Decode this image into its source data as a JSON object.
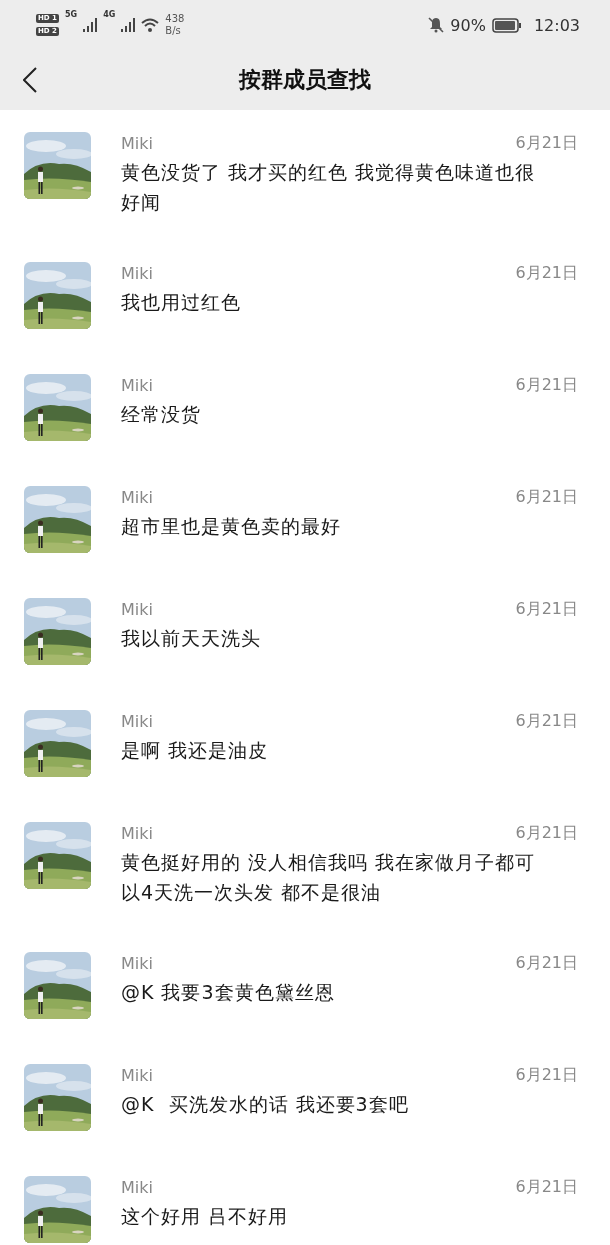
{
  "status_bar": {
    "sims": [
      {
        "label": "HD",
        "slot": "1"
      },
      {
        "label": "HD",
        "slot": "2"
      }
    ],
    "networks": [
      "5G",
      "4G"
    ],
    "speed": "438",
    "speed_unit": "B/s",
    "battery": "90%",
    "time": "12:03"
  },
  "header": {
    "title": "按群成员查找"
  },
  "messages": [
    {
      "name": "Miki",
      "date": "6月21日",
      "text": "黄色没货了 我才买的红色 我觉得黄色味道也很好闻"
    },
    {
      "name": "Miki",
      "date": "6月21日",
      "text": "我也用过红色"
    },
    {
      "name": "Miki",
      "date": "6月21日",
      "text": "经常没货"
    },
    {
      "name": "Miki",
      "date": "6月21日",
      "text": "超市里也是黄色卖的最好"
    },
    {
      "name": "Miki",
      "date": "6月21日",
      "text": "我以前天天洗头"
    },
    {
      "name": "Miki",
      "date": "6月21日",
      "text": "是啊 我还是油皮"
    },
    {
      "name": "Miki",
      "date": "6月21日",
      "text": "黄色挺好用的 没人相信我吗 我在家做月子都可以4天洗一次头发 都不是很油"
    },
    {
      "name": "Miki",
      "date": "6月21日",
      "text": "@K 我要3套黄色黛丝恩"
    },
    {
      "name": "Miki",
      "date": "6月21日",
      "text": "@K  买洗发水的话 我还要3套吧"
    },
    {
      "name": "Miki",
      "date": "6月21日",
      "text": "这个好用 吕不好用"
    }
  ]
}
